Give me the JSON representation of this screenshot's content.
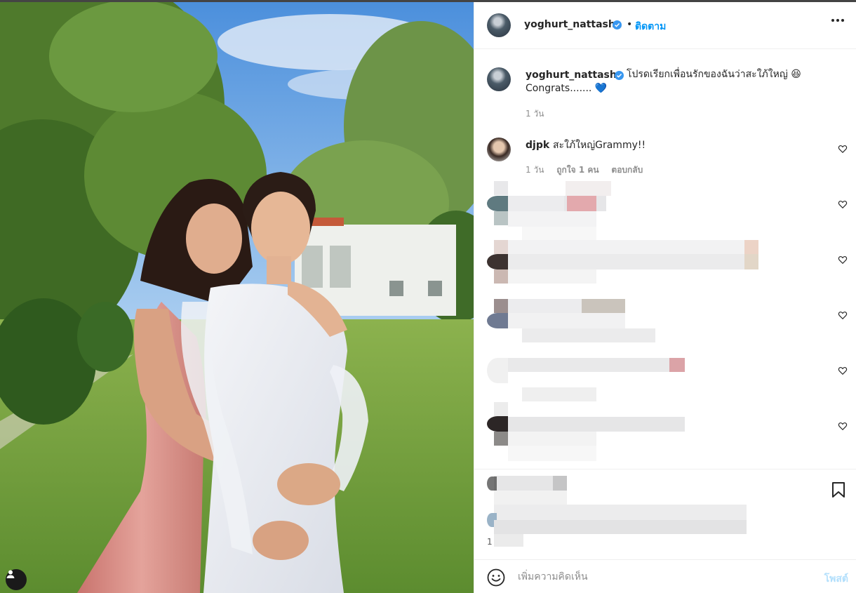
{
  "post": {
    "author": "yoghurt_nattasha",
    "follow_label": "ติดตาม",
    "dot": "•",
    "caption_line1": "โปรดเรียกเพื่อนรักของฉันว่าสะใภ้ใหญ่ 😆",
    "caption_line2": "Congrats....... 💙",
    "caption_time": "1 วัน"
  },
  "comments": [
    {
      "user": "djpk",
      "text": "สะใภ้ใหญ่Grammy!!",
      "time": "1 วัน",
      "likes": "ถูกใจ 1 คน",
      "reply": "ตอบกลับ"
    }
  ],
  "likes_partial": "1",
  "comment_box": {
    "placeholder": "เพิ่มความคิดเห็น",
    "post_label": "โพสต์"
  },
  "icons": {
    "verified": "verified-badge-icon",
    "more": "more-options-icon",
    "heart": "heart-outline-icon",
    "bookmark": "bookmark-icon",
    "emoji": "emoji-icon",
    "tag": "user-tag-icon"
  },
  "colors": {
    "accent": "#0095f6",
    "verified": "#3897f0",
    "muted": "#8e8e8e",
    "post_disabled": "#b2dffc"
  }
}
